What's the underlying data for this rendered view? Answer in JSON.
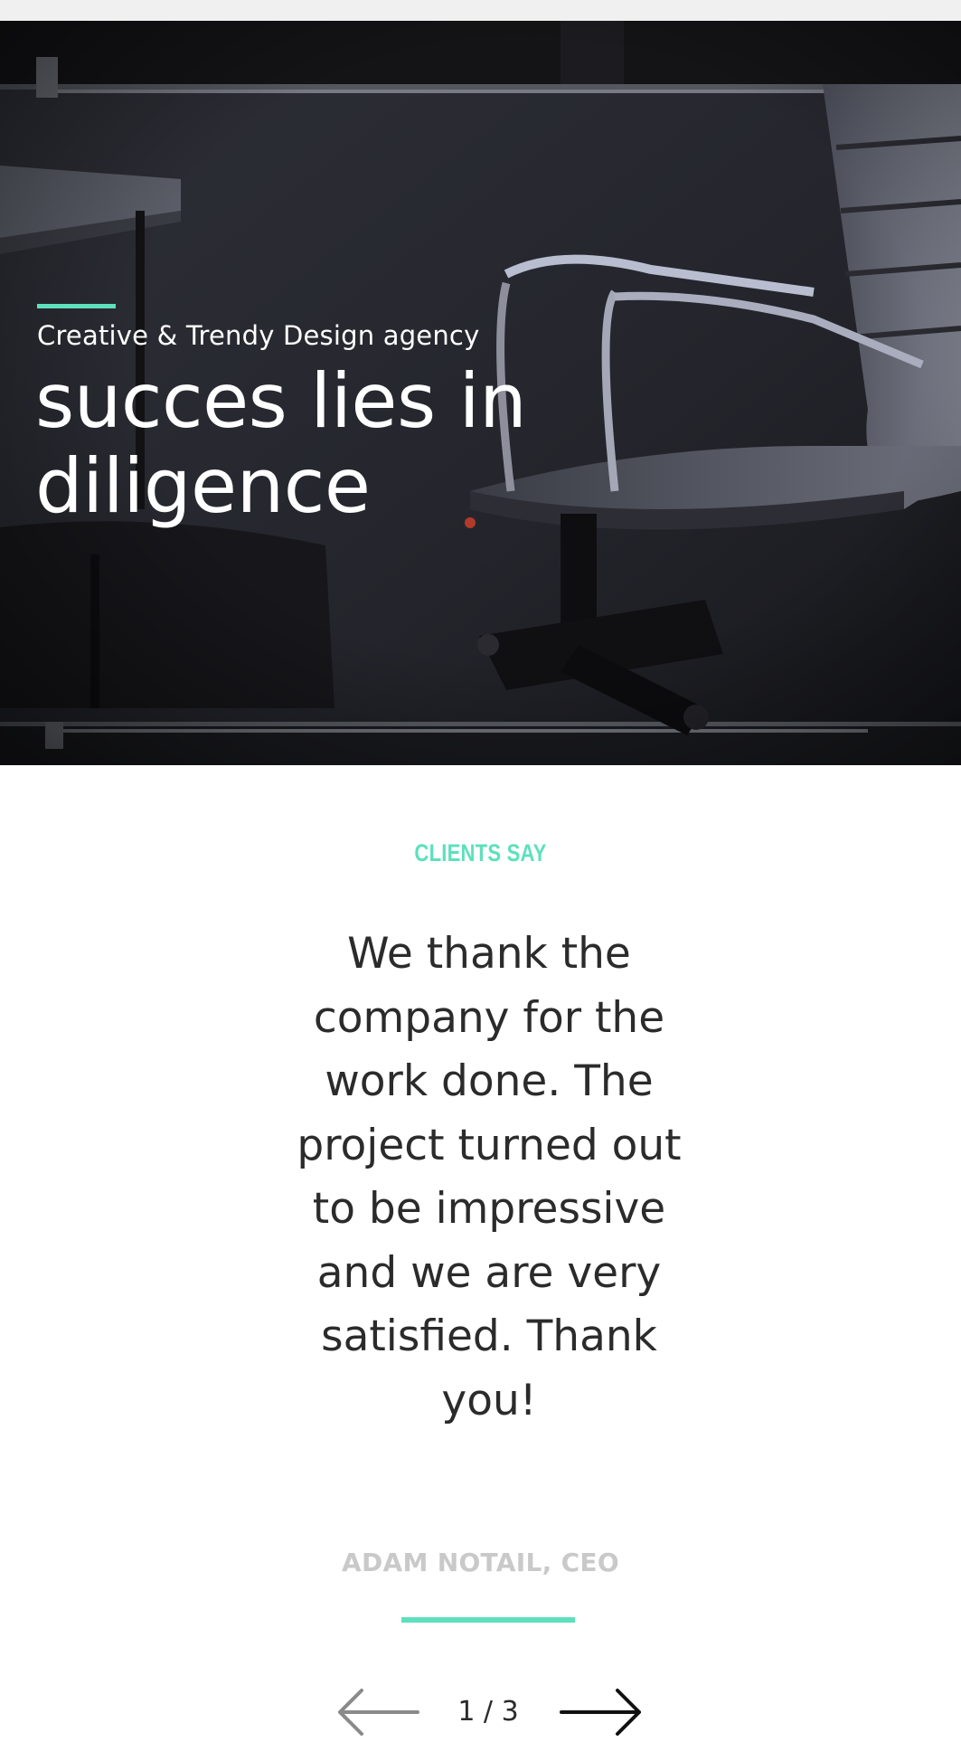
{
  "hero": {
    "tagline": "Creative & Trendy Design agency",
    "title": "succes lies in diligence",
    "accent_color": "#5ee0bd"
  },
  "testimonials": {
    "section_label": "CLIENTS SAY",
    "quote": "We thank the company for the work done. The project turned out to be impressive and we are very satisfied. Thank you!",
    "author": "ADAM NOTAIL, CEO"
  },
  "pager": {
    "counter": "1 / 3",
    "prev_icon": "arrow-left-icon",
    "next_icon": "arrow-right-icon"
  }
}
